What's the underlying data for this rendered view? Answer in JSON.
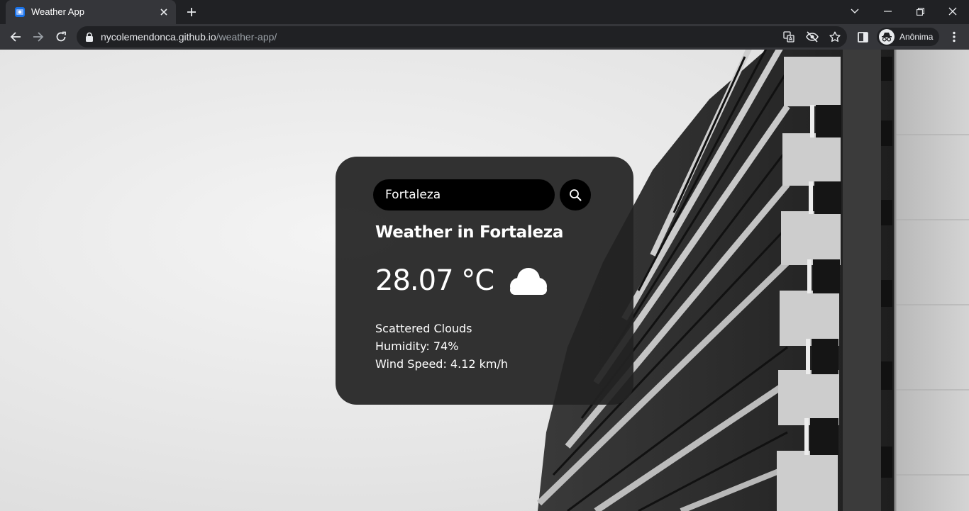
{
  "browser": {
    "tab": {
      "title": "Weather App",
      "favicon": "weather-app-icon"
    },
    "url": {
      "host": "nycolemendonca.github.io",
      "path": "/weather-app/"
    },
    "profile": {
      "label": "Anônima",
      "icon": "incognito-icon"
    },
    "icons": [
      "back-icon",
      "forward-icon",
      "reload-icon",
      "lock-icon",
      "translate-icon",
      "eye-off-icon",
      "star-icon",
      "sidebar-icon",
      "menu-icon",
      "minimize-icon",
      "restore-icon",
      "close-icon",
      "tab-search-icon",
      "new-tab-icon"
    ]
  },
  "weather": {
    "search": {
      "value": "Fortaleza",
      "placeholder": "Search"
    },
    "city_heading": "Weather in Fortaleza",
    "temperature": "28.07 °C",
    "condition_icon": "cloud-icon",
    "description": "Scattered Clouds",
    "humidity": "Humidity: 74%",
    "wind": "Wind Speed: 4.12 km/h"
  },
  "colors": {
    "card_bg": "#222222",
    "input_bg": "#000000",
    "text": "#ffffff",
    "page_bg": "#e6e6e6"
  }
}
